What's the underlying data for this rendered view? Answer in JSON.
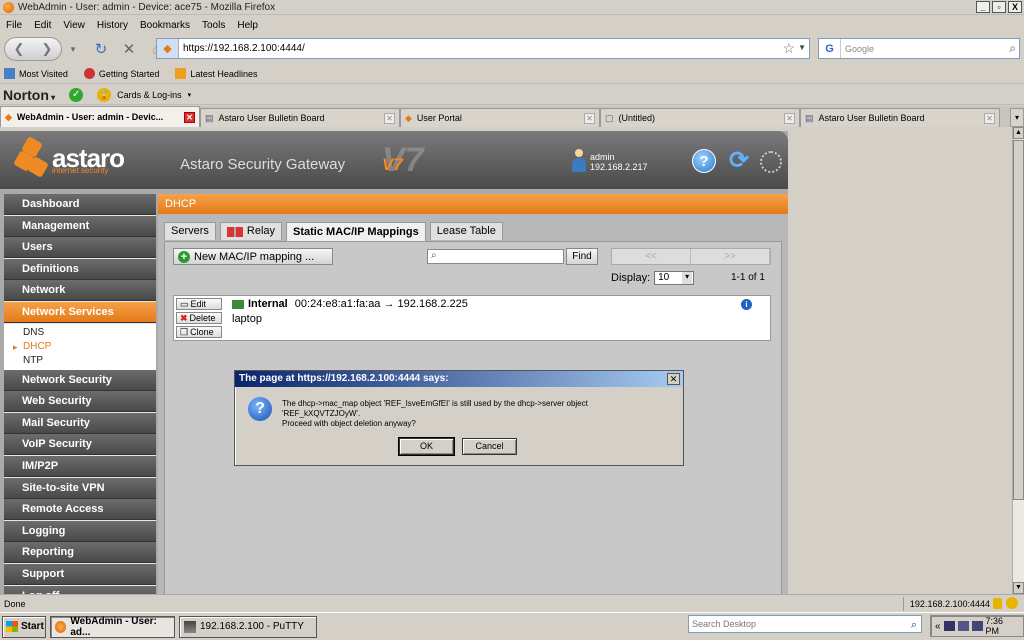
{
  "window": {
    "title": "WebAdmin - User: admin - Device: ace75 - Mozilla Firefox",
    "controls": [
      "_",
      "▫",
      "X"
    ]
  },
  "menubar": [
    "File",
    "Edit",
    "View",
    "History",
    "Bookmarks",
    "Tools",
    "Help"
  ],
  "navbar": {
    "url": "https://192.168.2.100:4444/",
    "search_placeholder": "Google"
  },
  "bookmarks": [
    "Most Visited",
    "Getting Started",
    "Latest Headlines"
  ],
  "norton": {
    "brand": "Norton",
    "cards": "Cards & Log-ins"
  },
  "tabs": [
    {
      "label": "WebAdmin - User: admin - Devic...",
      "active": true
    },
    {
      "label": "Astaro User Bulletin Board",
      "active": false
    },
    {
      "label": "User Portal",
      "active": false
    },
    {
      "label": "(Untitled)",
      "active": false
    },
    {
      "label": "Astaro User Bulletin Board",
      "active": false
    }
  ],
  "app": {
    "logo": "astaro",
    "logo_sub": "internet security",
    "gateway_title": "Astaro Security Gateway",
    "version": "V7",
    "user": {
      "name": "admin",
      "ip": "192.168.2.217"
    }
  },
  "sidebar": {
    "items": [
      {
        "label": "Dashboard"
      },
      {
        "label": "Management"
      },
      {
        "label": "Users"
      },
      {
        "label": "Definitions"
      },
      {
        "label": "Network"
      },
      {
        "label": "Network Services",
        "active": true
      }
    ],
    "subitems": [
      {
        "label": "DNS"
      },
      {
        "label": "DHCP",
        "active": true
      },
      {
        "label": "NTP"
      }
    ],
    "items_after": [
      {
        "label": "Network Security"
      },
      {
        "label": "Web Security"
      },
      {
        "label": "Mail Security"
      },
      {
        "label": "VoIP Security"
      },
      {
        "label": "IM/P2P"
      },
      {
        "label": "Site-to-site VPN"
      },
      {
        "label": "Remote Access"
      },
      {
        "label": "Logging"
      },
      {
        "label": "Reporting"
      },
      {
        "label": "Support"
      },
      {
        "label": "Log off"
      }
    ]
  },
  "content": {
    "section": "DHCP",
    "tabs": [
      "Servers",
      "Relay",
      "Static MAC/IP Mappings",
      "Lease Table"
    ],
    "new_button": "New MAC/IP mapping ...",
    "find_button": "Find",
    "pager_prev": "<<",
    "pager_next": ">>",
    "display_label": "Display:",
    "display_value": "10",
    "count": "1-1 of 1",
    "row": {
      "buttons": [
        "Edit",
        "Delete",
        "Clone"
      ],
      "interface": "Internal",
      "mapping": "00:24:e8:a1:fa:aa → 192.168.2.225",
      "comment": "laptop"
    }
  },
  "dialog": {
    "title": "The page at https://192.168.2.100:4444 says:",
    "line1": "The dhcp->mac_map object 'REF_IsveEmGfEI' is still used by the dhcp->server object",
    "line2": "'REF_kXQVTZJOyW'.",
    "line3": "Proceed with object deletion anyway?",
    "ok": "OK",
    "cancel": "Cancel"
  },
  "statusbar": {
    "text": "Done",
    "host": "192.168.2.100:4444"
  },
  "taskbar": {
    "start": "Start",
    "tasks": [
      "WebAdmin - User: ad...",
      "192.168.2.100 - PuTTY"
    ],
    "search_placeholder": "Search Desktop",
    "clock": "7:36 PM"
  }
}
